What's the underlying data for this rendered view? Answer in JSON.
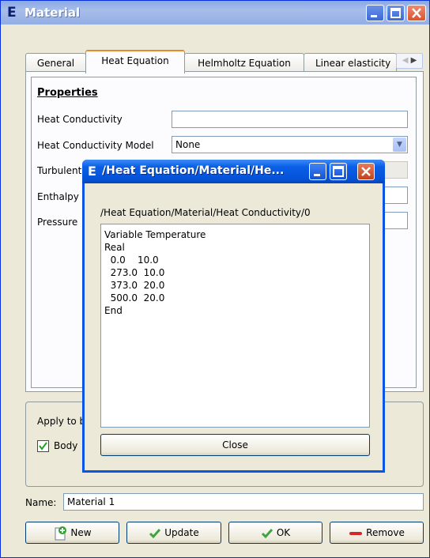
{
  "window": {
    "title": "Material",
    "icon_letter": "E"
  },
  "tabs": [
    {
      "label": "General"
    },
    {
      "label": "Heat Equation"
    },
    {
      "label": "Helmholtz Equation"
    },
    {
      "label": "Linear elasticity"
    }
  ],
  "tab_scroll": {
    "left": "◀",
    "right": "▶"
  },
  "properties": {
    "heading": "Properties",
    "heat_conductivity": {
      "label": "Heat Conductivity",
      "value": ""
    },
    "heat_conductivity_model": {
      "label": "Heat Conductivity Model",
      "value": "None"
    },
    "turbulent": {
      "label": "Turbulent"
    },
    "enthalpy": {
      "label": "Enthalpy",
      "value": ""
    },
    "pressure": {
      "label": "Pressure",
      "value": ""
    }
  },
  "apply": {
    "label": "Apply to b",
    "body_checkbox": {
      "label": "Body",
      "checked": true
    }
  },
  "name": {
    "label": "Name:",
    "value": "Material 1"
  },
  "buttons": {
    "new": "New",
    "update": "Update",
    "ok": "OK",
    "remove": "Remove"
  },
  "dialog": {
    "icon_letter": "E",
    "title": "/Heat Equation/Material/He...",
    "path": "/Heat Equation/Material/Heat Conductivity/0",
    "content": "Variable Temperature\nReal\n  0.0    10.0\n  273.0  10.0\n  373.0  20.0\n  500.0  20.0\nEnd",
    "close_label": "Close"
  }
}
